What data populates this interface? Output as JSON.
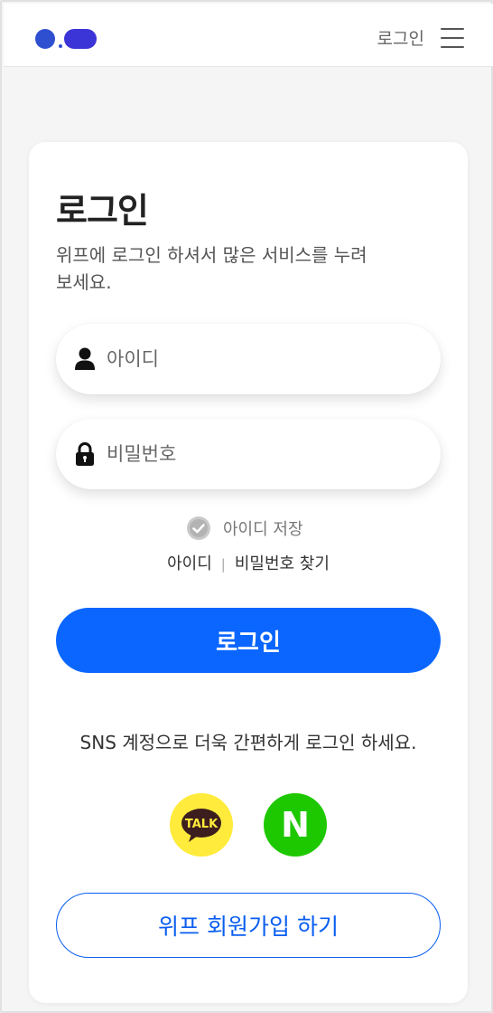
{
  "header": {
    "login_label": "로그인",
    "logo_colors": [
      "#2f4fd1",
      "#3b34d6"
    ]
  },
  "card": {
    "title": "로그인",
    "subtitle": "위프에 로그인 하셔서 많은 서비스를 누려보세요."
  },
  "form": {
    "id_placeholder": "아이디",
    "id_value": "",
    "password_placeholder": "비밀번호",
    "password_value": "",
    "remember_label": "아이디 저장",
    "remember_checked": true,
    "find_id_label": "아이디",
    "find_separator": "|",
    "find_password_label": "비밀번호 찾기",
    "login_button_label": "로그인"
  },
  "sns": {
    "text": "SNS 계정으로 더욱 간편하게 로그인 하세요.",
    "providers": [
      {
        "name": "kakao",
        "badge_text": "TALK",
        "color": "#ffeb3b"
      },
      {
        "name": "naver",
        "badge_text": "N",
        "color": "#1ec800"
      }
    ]
  },
  "signup_button_label": "위프 회원가입 하기",
  "colors": {
    "primary": "#0a66ff",
    "background": "#f5f5f6"
  },
  "icons": [
    "menu-icon",
    "user-icon",
    "lock-icon",
    "check-circle-icon",
    "kakao-talk-icon",
    "naver-icon"
  ]
}
